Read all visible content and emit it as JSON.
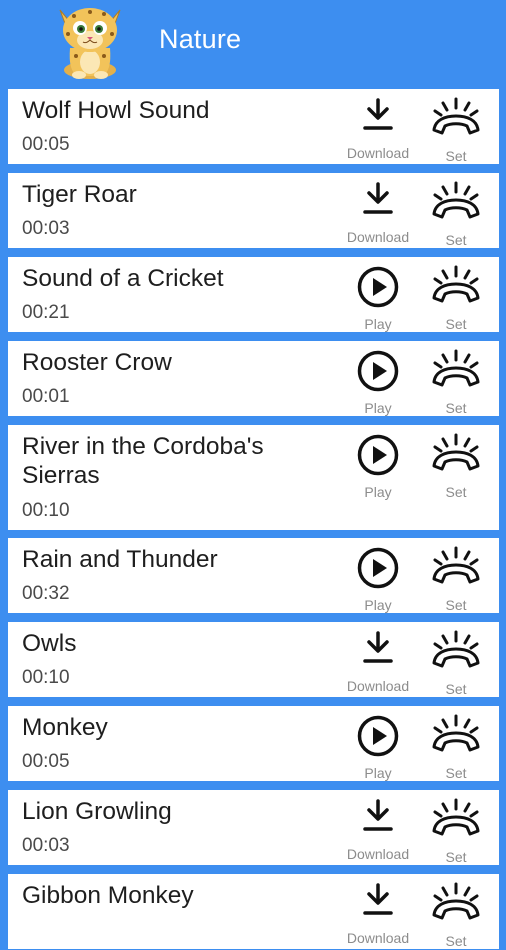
{
  "header": {
    "title": "Nature"
  },
  "labels": {
    "download": "Download",
    "play": "Play",
    "set": "Set"
  },
  "sounds": [
    {
      "name": "Wolf Howl Sound",
      "duration": "00:05",
      "action": "download"
    },
    {
      "name": "Tiger Roar",
      "duration": "00:03",
      "action": "download"
    },
    {
      "name": "Sound of a Cricket",
      "duration": "00:21",
      "action": "play"
    },
    {
      "name": "Rooster Crow",
      "duration": "00:01",
      "action": "play"
    },
    {
      "name": "River in the Cordoba's Sierras",
      "duration": "00:10",
      "action": "play"
    },
    {
      "name": "Rain and Thunder",
      "duration": "00:32",
      "action": "play"
    },
    {
      "name": "Owls",
      "duration": "00:10",
      "action": "download"
    },
    {
      "name": "Monkey",
      "duration": "00:05",
      "action": "play"
    },
    {
      "name": "Lion Growling",
      "duration": "00:03",
      "action": "download"
    },
    {
      "name": "Gibbon Monkey",
      "duration": "",
      "action": "download"
    }
  ]
}
